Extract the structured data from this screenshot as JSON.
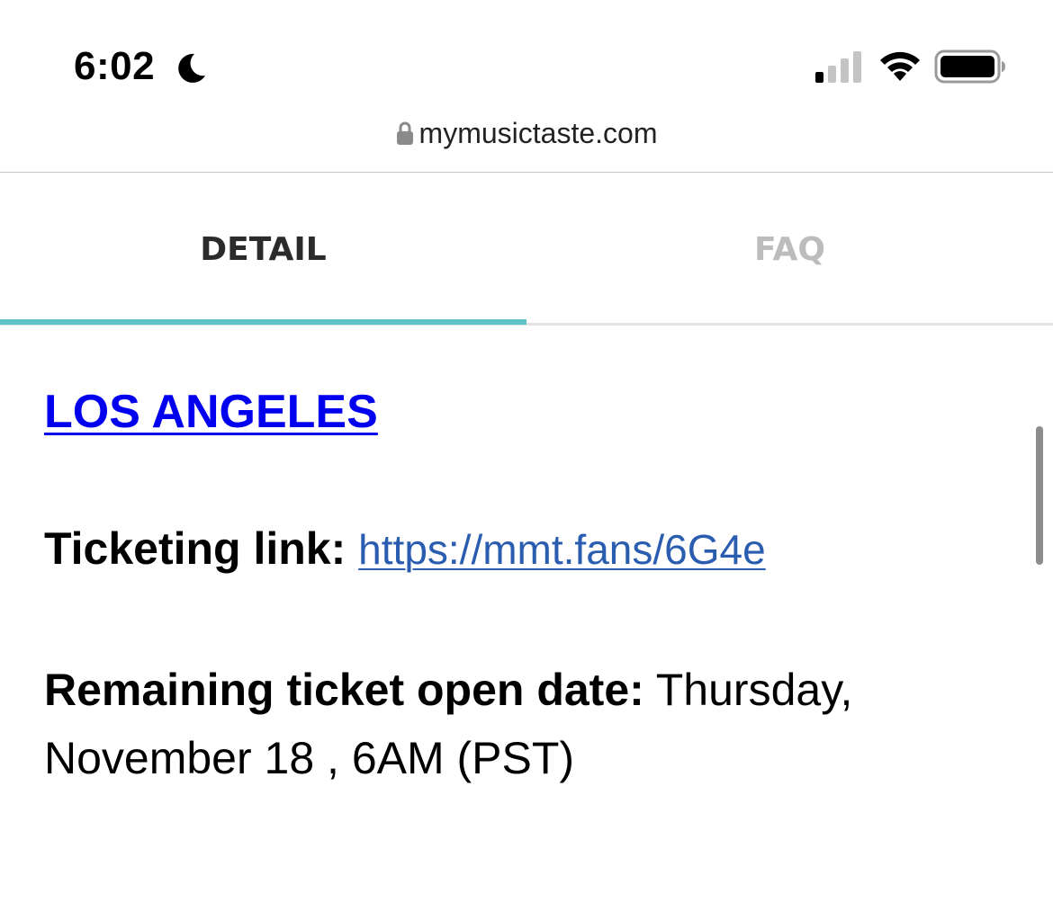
{
  "status_bar": {
    "time": "6:02",
    "moon_icon": "moon-icon",
    "signal_icon": "cellular-signal-icon",
    "wifi_icon": "wifi-icon",
    "battery_icon": "battery-icon"
  },
  "browser": {
    "url": "mymusictaste.com",
    "lock_icon": "lock-icon"
  },
  "tabs": [
    {
      "label": "DETAIL",
      "active": true
    },
    {
      "label": "FAQ",
      "active": false
    }
  ],
  "colors": {
    "active_tab_underline": "#5fc3c8",
    "link_blue": "#0000ee",
    "ticket_link": "#2a5db0",
    "inactive_tab": "#bcbcbc"
  },
  "content": {
    "city": "LOS ANGELES",
    "ticketing_label": "Ticketing link:",
    "ticketing_url": "https://mmt.fans/6G4e",
    "open_date_label": "Remaining ticket open date:",
    "open_date_value": " Thursday, November 18 , 6AM (PST)"
  }
}
